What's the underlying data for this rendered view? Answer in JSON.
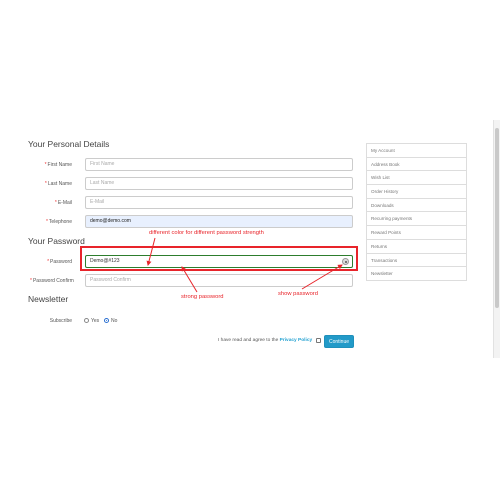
{
  "personal": {
    "title": "Your Personal Details",
    "fields": [
      {
        "label": "First Name",
        "required": "*",
        "value": "",
        "placeholder": "First Name"
      },
      {
        "label": "Last Name",
        "required": "*",
        "value": "",
        "placeholder": "Last Name"
      },
      {
        "label": "E-Mail",
        "required": "*",
        "value": "",
        "placeholder": "E-Mail"
      },
      {
        "label": "Telephone",
        "required": "*",
        "value": "demo@demo.com",
        "placeholder": "Telephone"
      }
    ]
  },
  "password": {
    "title": "Your Password",
    "password_label": "Password",
    "password_value": "Demo@#123",
    "confirm_label": "Password Confirm",
    "confirm_placeholder": "Password Confirm",
    "required": "*",
    "strength_color": "#2d7d2d"
  },
  "annotations": {
    "color": "#e8242a",
    "color_note": "different color for different password strength",
    "strong": "strong password",
    "show": "show password"
  },
  "newsletter": {
    "title": "Newsletter",
    "subscribe_label": "Subscribe",
    "yes": "Yes",
    "no": "No",
    "selected": "No"
  },
  "agree": {
    "text": "I have read and agree to the",
    "link": "Privacy Policy"
  },
  "continue_label": "Continue",
  "accent": "#229ac8",
  "sidebar": {
    "items": [
      "My Account",
      "Address Book",
      "Wish List",
      "Order History",
      "Downloads",
      "Recurring payments",
      "Reward Points",
      "Returns",
      "Transactions",
      "Newsletter"
    ]
  }
}
